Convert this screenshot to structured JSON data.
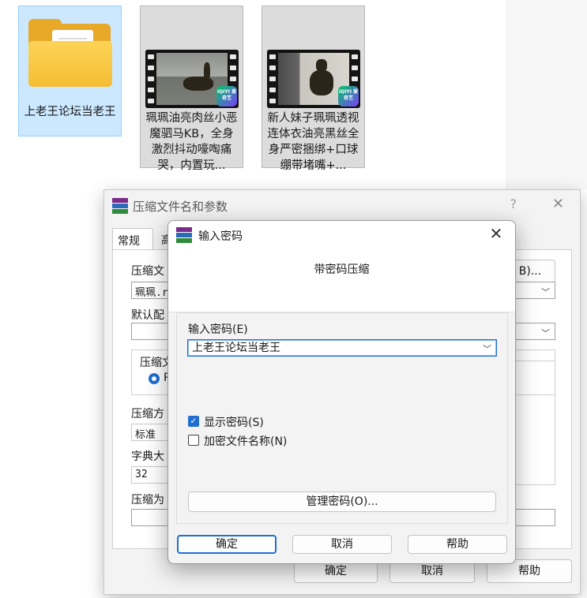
{
  "desktop": {
    "items": [
      {
        "label": "上老王论坛当老王",
        "icon": "folder-icon"
      },
      {
        "label": "珮珮油亮肉丝小恶魔驷马KB，全身激烈抖动嚎啕痛哭，内置玩...",
        "icon": "video-thumbnail-icon",
        "badge": "iQIYI 爱奇艺"
      },
      {
        "label": "新人妹子珮珮透视连体衣油亮黑丝全身严密捆绑+口球绷带堵嘴+...",
        "icon": "video-thumbnail-icon",
        "badge": "iQIYI 爱奇艺"
      }
    ]
  },
  "archive_dialog": {
    "title": "压缩文件名和参数",
    "help_glyph": "?",
    "close_glyph": "✕",
    "tabs": [
      "常规",
      "高"
    ],
    "archive_name_label": "压缩文",
    "archive_name_value": "珮珮.r",
    "browse_label": "B)...",
    "default_profile_label": "默认配",
    "format_group_label": "压缩文",
    "format_option": "R",
    "method_label": "压缩方",
    "method_value": "标准",
    "dict_label": "字典大",
    "dict_value": "32",
    "split_label": "压缩为",
    "ok_label": "确定",
    "cancel_label": "取消",
    "help_label": "帮助"
  },
  "password_dialog": {
    "title": "输入密码",
    "close_glyph": "✕",
    "subtitle": "带密码压缩",
    "password_label": "输入密码(E)",
    "password_value": "上老王论坛当老王",
    "show_password_label": "显示密码(S)",
    "show_password_checked": true,
    "encrypt_names_label": "加密文件名称(N)",
    "encrypt_names_checked": false,
    "manage_label": "管理密码(O)...",
    "ok_label": "确定",
    "cancel_label": "取消",
    "help_label": "帮助"
  },
  "colors": {
    "accent": "#1f6fd1",
    "selection": "#cce8ff",
    "dialog_bg": "#f3f3f3"
  }
}
